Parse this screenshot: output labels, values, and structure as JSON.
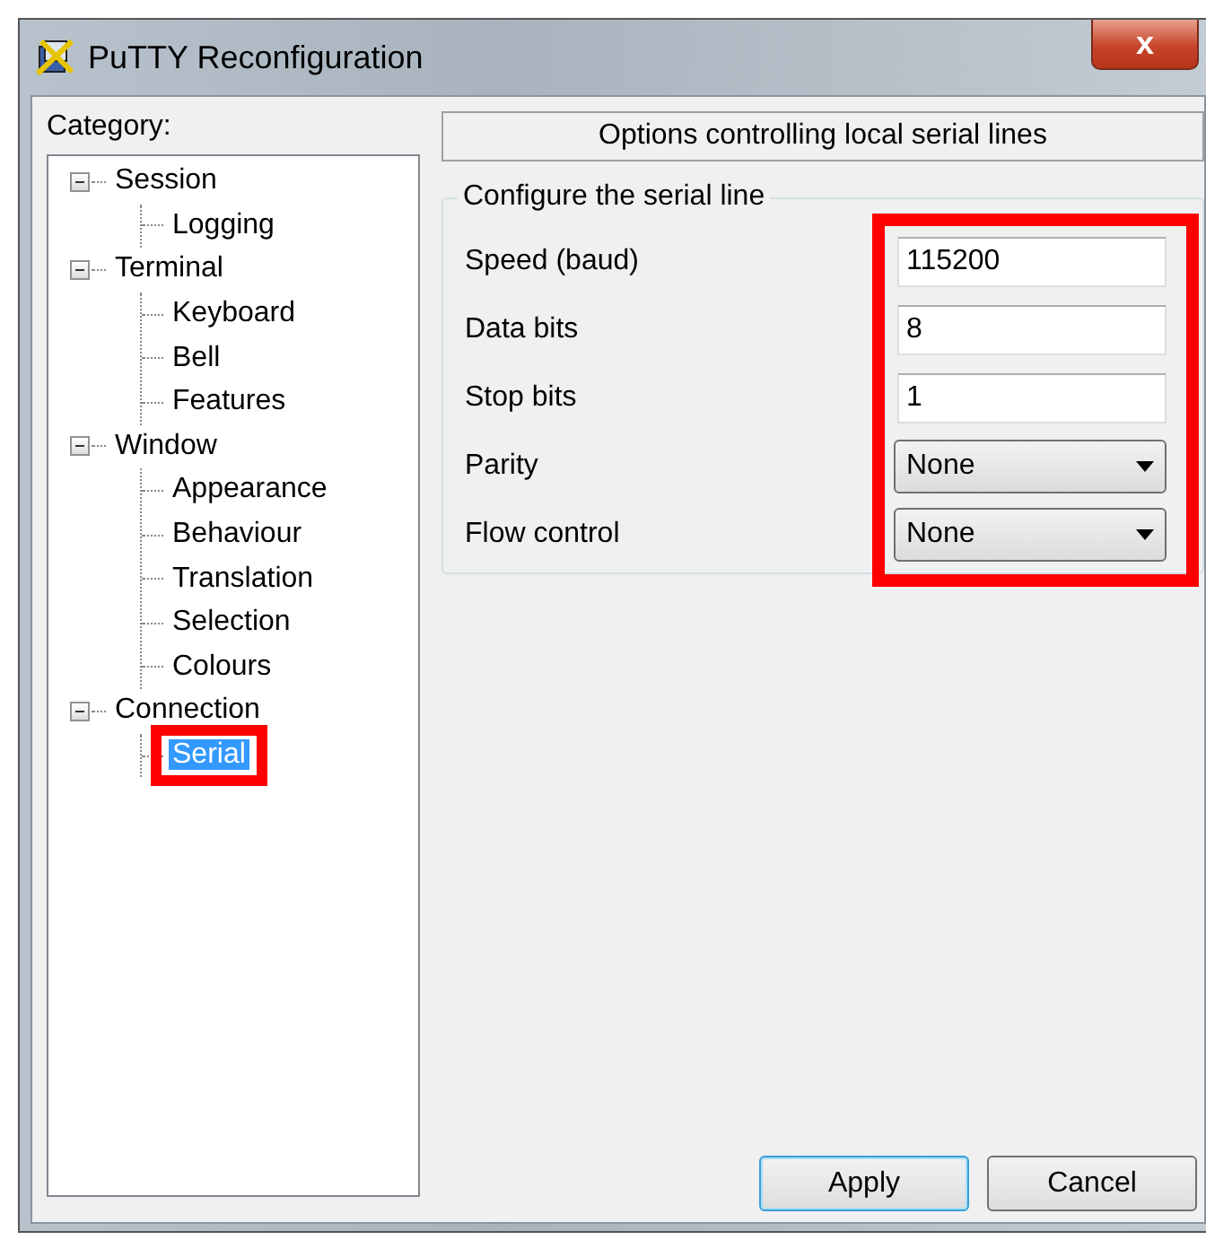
{
  "window": {
    "title": "PuTTY Reconfiguration",
    "close_label": "x"
  },
  "category_label": "Category:",
  "tree": [
    {
      "label": "Session",
      "expanded": true,
      "selected": false,
      "children": [
        {
          "label": "Logging",
          "selected": false,
          "highlighted": false
        }
      ]
    },
    {
      "label": "Terminal",
      "expanded": true,
      "selected": false,
      "children": [
        {
          "label": "Keyboard",
          "selected": false,
          "highlighted": false
        },
        {
          "label": "Bell",
          "selected": false,
          "highlighted": false
        },
        {
          "label": "Features",
          "selected": false,
          "highlighted": false
        }
      ]
    },
    {
      "label": "Window",
      "expanded": true,
      "selected": false,
      "children": [
        {
          "label": "Appearance",
          "selected": false,
          "highlighted": false
        },
        {
          "label": "Behaviour",
          "selected": false,
          "highlighted": false
        },
        {
          "label": "Translation",
          "selected": false,
          "highlighted": false
        },
        {
          "label": "Selection",
          "selected": false,
          "highlighted": false
        },
        {
          "label": "Colours",
          "selected": false,
          "highlighted": false
        }
      ]
    },
    {
      "label": "Connection",
      "expanded": true,
      "selected": false,
      "children": [
        {
          "label": "Serial",
          "selected": true,
          "highlighted": true
        }
      ]
    }
  ],
  "panel_header": "Options controlling local serial lines",
  "group": {
    "title": "Configure the serial line",
    "controls_highlighted": true,
    "fields": [
      {
        "label": "Speed (baud)",
        "kind": "text",
        "value": "115200"
      },
      {
        "label": "Data bits",
        "kind": "text",
        "value": "8"
      },
      {
        "label": "Stop bits",
        "kind": "text",
        "value": "1"
      },
      {
        "label": "Parity",
        "kind": "dropdown",
        "value": "None"
      },
      {
        "label": "Flow control",
        "kind": "dropdown",
        "value": "None"
      }
    ]
  },
  "buttons": [
    {
      "label": "Apply",
      "default": true
    },
    {
      "label": "Cancel",
      "default": false
    }
  ]
}
